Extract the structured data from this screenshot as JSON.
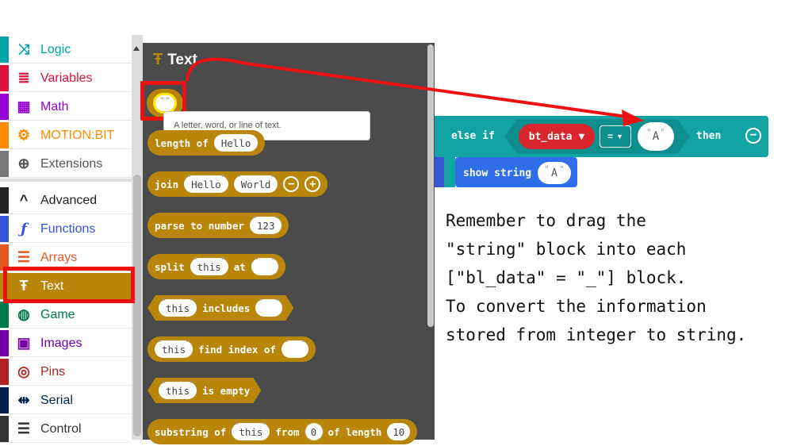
{
  "sidebar": {
    "items": [
      {
        "label": "Logic",
        "icon": "shuffle-icon",
        "color": "#00a4a6",
        "glyph": "⤨"
      },
      {
        "label": "Variables",
        "icon": "list-lines-icon",
        "color": "#dc143c",
        "glyph": "≣"
      },
      {
        "label": "Math",
        "icon": "calculator-icon",
        "color": "#9400d3",
        "glyph": "▦"
      },
      {
        "label": "MOTION:BIT",
        "icon": "gears-icon",
        "color": "#ff8c00",
        "glyph": "⚙"
      },
      {
        "label": "Extensions",
        "icon": "plus-circle-icon",
        "color": "#777777",
        "glyph": "⊕"
      },
      {
        "label": "Advanced",
        "icon": "chevron-up-icon",
        "color": "#222222",
        "glyph": "^"
      },
      {
        "label": "Functions",
        "icon": "function-icon",
        "color": "#3455db",
        "glyph": "ƒ"
      },
      {
        "label": "Arrays",
        "icon": "ordered-list-icon",
        "color": "#e65722",
        "glyph": "☰"
      },
      {
        "label": "Text",
        "icon": "text-icon",
        "color": "#b8860b",
        "glyph": "Ŧ"
      },
      {
        "label": "Game",
        "icon": "gamepad-icon",
        "color": "#007a4b",
        "glyph": "◍"
      },
      {
        "label": "Images",
        "icon": "image-icon",
        "color": "#7600a8",
        "glyph": "▣"
      },
      {
        "label": "Pins",
        "icon": "target-icon",
        "color": "#b22222",
        "glyph": "◎"
      },
      {
        "label": "Serial",
        "icon": "usb-icon",
        "color": "#002050",
        "glyph": "⇹"
      },
      {
        "label": "Control",
        "icon": "server-icon",
        "color": "#333333",
        "glyph": "☰"
      }
    ]
  },
  "flyout": {
    "title": "Text",
    "string_quotes": "\" \"",
    "tooltip": "A letter, word, or line of text.",
    "length_of": {
      "label": "length of",
      "value": "Hello"
    },
    "join": {
      "label": "join",
      "a": "Hello",
      "b": "World"
    },
    "parse": {
      "label": "parse to number",
      "value": "123"
    },
    "split": {
      "label": "split",
      "a": "this",
      "at": "at"
    },
    "includes": {
      "a": "this",
      "label": "includes"
    },
    "find_index": {
      "a": "this",
      "label": "find index of"
    },
    "is_empty": {
      "a": "this",
      "label": "is empty"
    },
    "substring": {
      "label": "substring of",
      "a": "this",
      "from": "from",
      "from_v": "0",
      "of_length": "of length",
      "len_v": "10"
    }
  },
  "workspace": {
    "else_if": "else if",
    "variable": "bt_data",
    "operator": "=",
    "value": "A",
    "then": "then",
    "show_string": "show string",
    "show_value": "A"
  },
  "note": {
    "lines": [
      "Remember to drag the",
      "\"string\" block into each",
      "[\"bl_data\" = \"_\"] block.",
      "To convert the information",
      "stored from integer to string."
    ]
  },
  "colors": {
    "text_category": "#b8860b",
    "highlight": "#ee1111",
    "logic": "#12a3a3",
    "variable": "#d9262c"
  }
}
